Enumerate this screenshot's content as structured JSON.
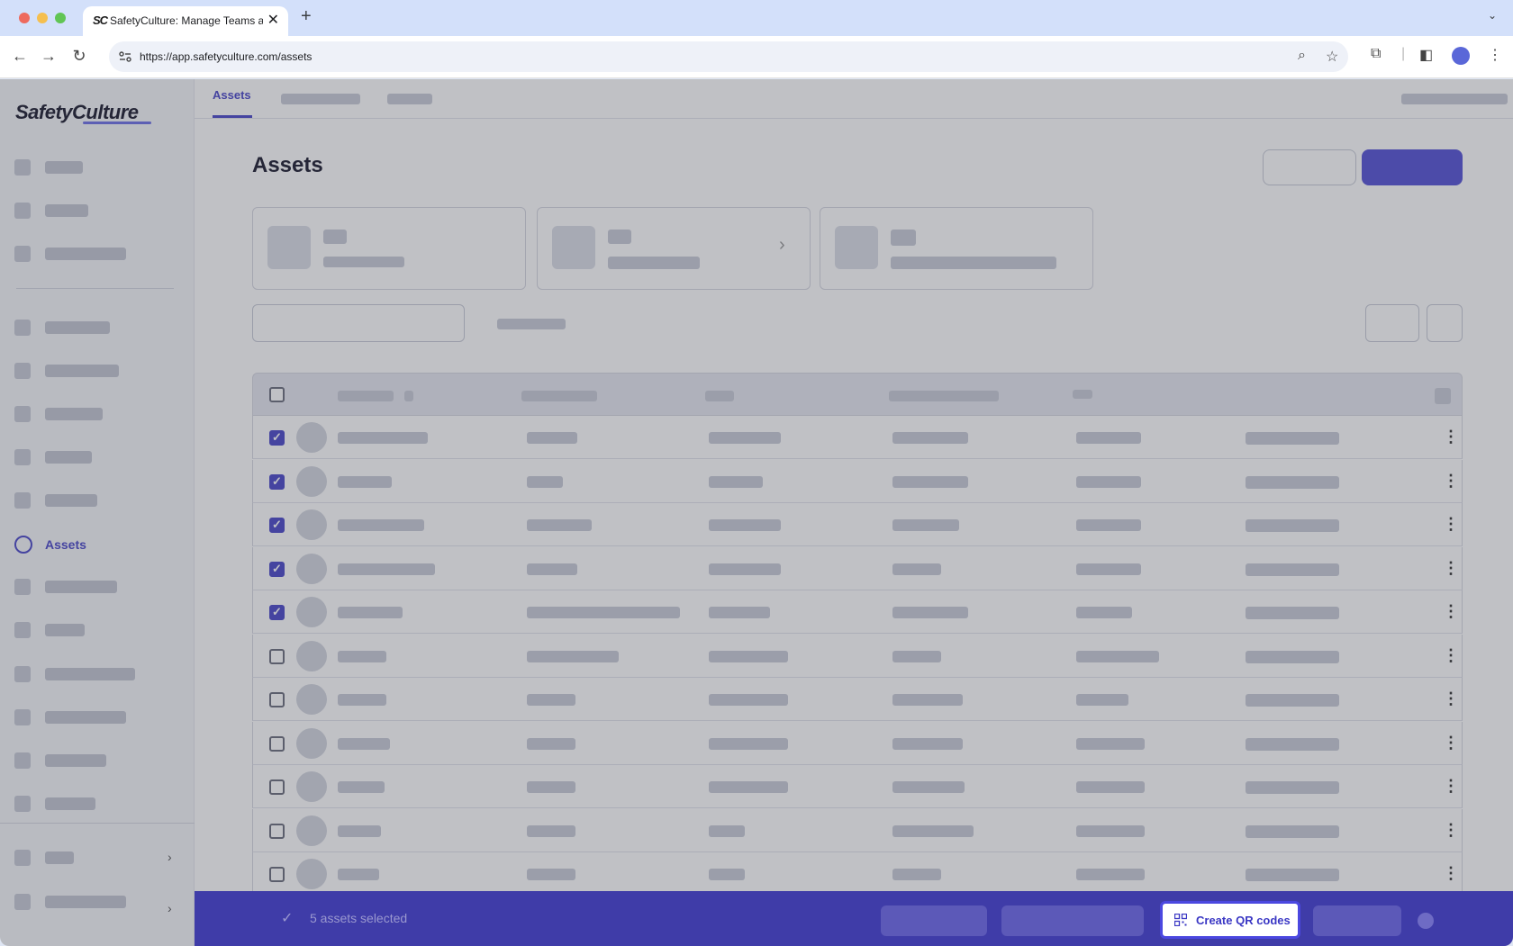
{
  "browser": {
    "tab_favicon": "SC",
    "tab_title": "SafetyCulture: Manage Teams and...",
    "url": "https://app.safetyculture.com/assets"
  },
  "sidebar": {
    "logo": "SafetyCulture",
    "active_item": "Assets"
  },
  "main": {
    "subtab_active": "Assets",
    "page_title": "Assets"
  },
  "table": {
    "checked_rows": [
      true,
      true,
      true,
      true,
      true,
      false,
      false,
      false,
      false,
      false,
      false
    ]
  },
  "action_bar": {
    "selection_text": "5 assets selected",
    "create_qr_label": "Create QR codes"
  },
  "colors": {
    "brand": "#4b48c9",
    "action_bar": "#3f3ca8"
  },
  "icons": [
    "back-icon",
    "forward-icon",
    "reload-icon",
    "site-info-icon",
    "zoom-icon",
    "star-icon",
    "extensions-icon",
    "sidepanel-icon",
    "profile-icon",
    "menu-icon",
    "qr-code-icon",
    "check-icon",
    "close-icon"
  ]
}
